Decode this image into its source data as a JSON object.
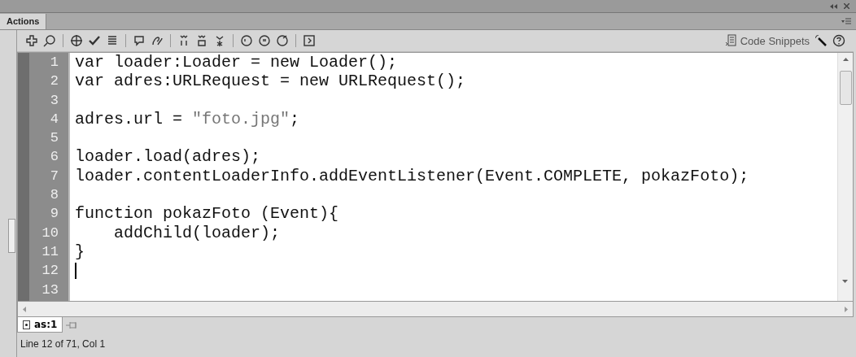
{
  "panel": {
    "tab": "Actions"
  },
  "toolbar": {
    "snippets_label": "Code Snippets"
  },
  "editor": {
    "lines": [
      {
        "number": "1",
        "segments": [
          {
            "kind": "plain",
            "text": "var loader:Loader = new Loader();"
          }
        ]
      },
      {
        "number": "2",
        "segments": [
          {
            "kind": "plain",
            "text": "var adres:URLRequest = new URLRequest();"
          }
        ]
      },
      {
        "number": "3"
      },
      {
        "number": "4",
        "segments": [
          {
            "kind": "plain",
            "text": "adres.url = "
          },
          {
            "kind": "string",
            "text": "\"foto.jpg\""
          },
          {
            "kind": "plain",
            "text": ";"
          }
        ]
      },
      {
        "number": "5"
      },
      {
        "number": "6",
        "segments": [
          {
            "kind": "plain",
            "text": "loader.load(adres);"
          }
        ]
      },
      {
        "number": "7",
        "segments": [
          {
            "kind": "plain",
            "text": "loader.contentLoaderInfo.addEventListener(Event.COMPLETE, pokazFoto);"
          }
        ]
      },
      {
        "number": "8"
      },
      {
        "number": "9",
        "segments": [
          {
            "kind": "plain",
            "text": "function pokazFoto (Event){"
          }
        ]
      },
      {
        "number": "10",
        "segments": [
          {
            "kind": "plain",
            "text": "    addChild(loader);"
          }
        ]
      },
      {
        "number": "11",
        "segments": [
          {
            "kind": "plain",
            "text": "}"
          }
        ]
      },
      {
        "number": "12",
        "cursor": true
      },
      {
        "number": "13"
      }
    ]
  },
  "script_tabs": [
    {
      "label": "as:1",
      "selected": true
    }
  ],
  "status_bar": "Line 12 of 71, Col 1"
}
